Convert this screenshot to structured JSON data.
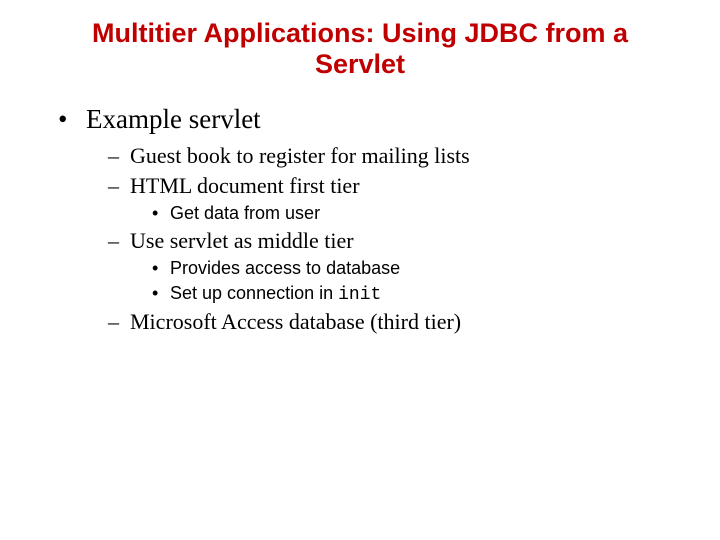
{
  "title": "Multitier Applications: Using JDBC from a Servlet",
  "b1": "Example servlet",
  "b2a": "Guest book to register for mailing lists",
  "b2b": "HTML document first tier",
  "b3a": "Get data from user",
  "b2c": "Use servlet as middle tier",
  "b3b": "Provides access to database",
  "b3c_prefix": "Set up connection in ",
  "b3c_code": "init",
  "b2d": "Microsoft Access database (third tier)"
}
